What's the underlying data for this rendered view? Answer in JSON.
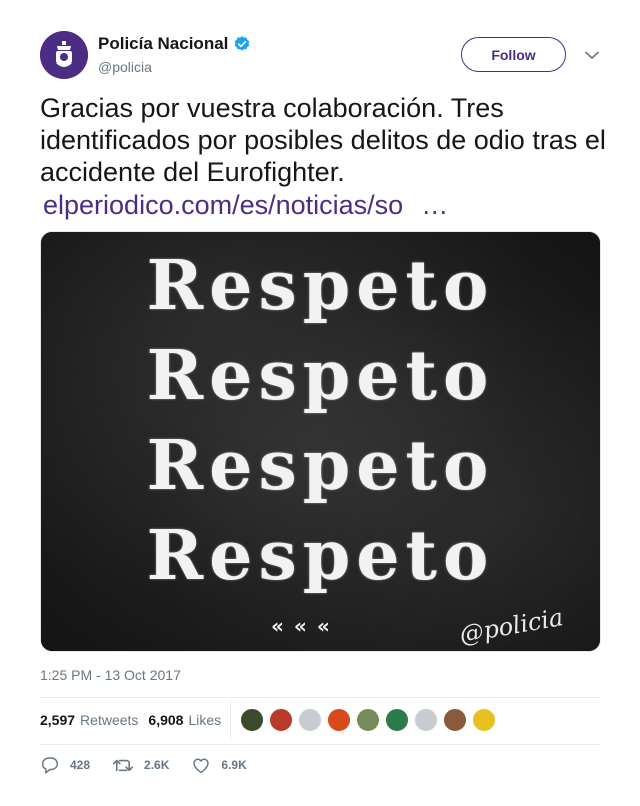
{
  "header": {
    "name": "Policía Nacional",
    "handle": "@policia",
    "follow_label": "Follow",
    "verified_icon": "verified-badge-icon",
    "brand_color": "#4b2e83"
  },
  "tweet": {
    "text": "Gracias por vuestra colaboración. Tres identificados por posibles delitos de odio tras el accidente del Eurofighter.",
    "link_text": "elperiodico.com/es/noticias/so",
    "link_ellipsis": "…",
    "link_color": "#4b2e83"
  },
  "media": {
    "lines": [
      "Respeto",
      "Respeto",
      "Respeto",
      "Respeto"
    ],
    "quote_marks": "«««",
    "watermark": "@policia"
  },
  "timestamp": "1:25 PM - 13 Oct 2017",
  "stats": {
    "retweets_count": "2,597",
    "retweets_label": "Retweets",
    "likes_count": "6,908",
    "likes_label": "Likes",
    "liker_avatar_colors": [
      "#3a4a2a",
      "#b83a2a",
      "#c8ccd0",
      "#d84a1a",
      "#7a8a5a",
      "#2a7a4a",
      "#c8ccd0",
      "#8a5a3a",
      "#e8c020"
    ]
  },
  "actions": {
    "replies": "428",
    "retweets": "2.6K",
    "likes": "6.9K"
  }
}
